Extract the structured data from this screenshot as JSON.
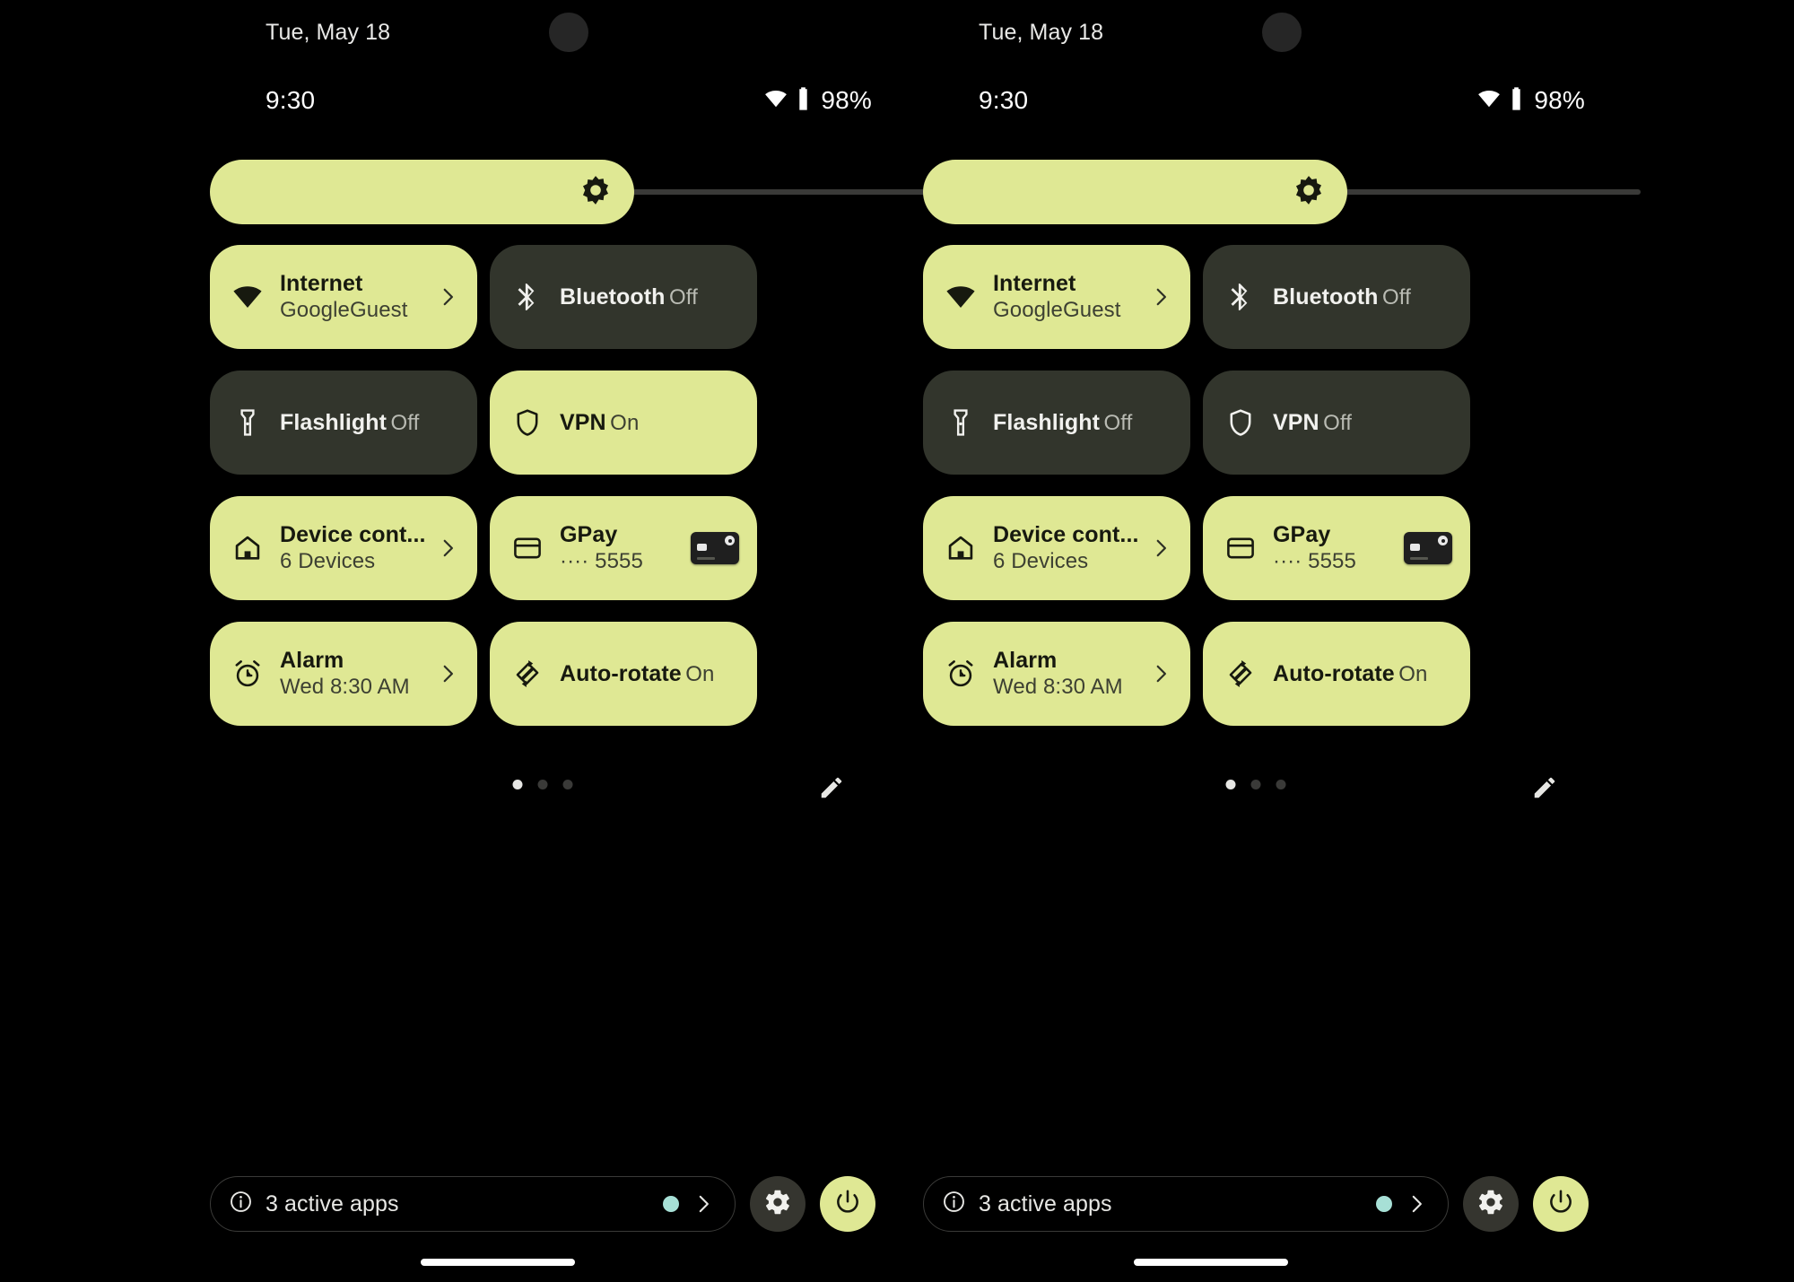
{
  "theme": {
    "background": "#000000",
    "tile_active_bg": "#dfe894",
    "tile_inactive_bg": "#32352c",
    "accent": "#dfe894",
    "active_apps_dot": "#a7e0d6"
  },
  "panels": [
    {
      "id": "panel-left",
      "status_bar": {
        "date": "Tue, May 18",
        "time": "9:30",
        "wifi_icon": "wifi-icon",
        "battery_icon": "battery-icon",
        "battery_percent": "98%"
      },
      "brightness": {
        "name": "brightness-slider",
        "icon": "brightness-icon",
        "value_percent": 59
      },
      "tiles": [
        {
          "name": "internet",
          "label": "Internet",
          "state": "GoogleGuest",
          "icon": "wifi-icon",
          "active": true,
          "chevron": true,
          "thumbnail": null
        },
        {
          "name": "bluetooth",
          "label": "Bluetooth",
          "state": "Off",
          "icon": "bluetooth-icon",
          "active": false,
          "chevron": false,
          "thumbnail": null
        },
        {
          "name": "flashlight",
          "label": "Flashlight",
          "state": "Off",
          "icon": "flashlight-icon",
          "active": false,
          "chevron": false,
          "thumbnail": null
        },
        {
          "name": "vpn",
          "label": "VPN",
          "state": "On",
          "icon": "shield-icon",
          "active": true,
          "chevron": false,
          "thumbnail": null
        },
        {
          "name": "device-controls",
          "label": "Device cont...",
          "state": "6 Devices",
          "icon": "home-icon",
          "active": true,
          "chevron": true,
          "thumbnail": null
        },
        {
          "name": "gpay",
          "label": "GPay",
          "state": "···· 5555",
          "icon": "credit-card-icon",
          "active": true,
          "chevron": false,
          "thumbnail": "payment-card-thumbnail"
        },
        {
          "name": "alarm",
          "label": "Alarm",
          "state": "Wed 8:30 AM",
          "icon": "alarm-clock-icon",
          "active": true,
          "chevron": true,
          "thumbnail": null
        },
        {
          "name": "auto-rotate",
          "label": "Auto-rotate",
          "state": "On",
          "icon": "auto-rotate-icon",
          "active": true,
          "chevron": false,
          "thumbnail": null
        }
      ],
      "pager": {
        "pages": 3,
        "current": 1
      },
      "edit_button": {
        "name": "edit-tiles-button",
        "icon": "pencil-icon"
      },
      "bottom": {
        "active_apps_label": "3 active apps",
        "info_icon": "info-icon",
        "chevron_icon": "chevron-right-icon",
        "settings_icon": "gear-icon",
        "power_icon": "power-icon"
      }
    },
    {
      "id": "panel-right",
      "status_bar": {
        "date": "Tue, May 18",
        "time": "9:30",
        "wifi_icon": "wifi-icon",
        "battery_icon": "battery-icon",
        "battery_percent": "98%"
      },
      "brightness": {
        "name": "brightness-slider",
        "icon": "brightness-icon",
        "value_percent": 59
      },
      "tiles": [
        {
          "name": "internet",
          "label": "Internet",
          "state": "GoogleGuest",
          "icon": "wifi-icon",
          "active": true,
          "chevron": true,
          "thumbnail": null
        },
        {
          "name": "bluetooth",
          "label": "Bluetooth",
          "state": "Off",
          "icon": "bluetooth-icon",
          "active": false,
          "chevron": false,
          "thumbnail": null
        },
        {
          "name": "flashlight",
          "label": "Flashlight",
          "state": "Off",
          "icon": "flashlight-icon",
          "active": false,
          "chevron": false,
          "thumbnail": null
        },
        {
          "name": "vpn",
          "label": "VPN",
          "state": "Off",
          "icon": "shield-icon",
          "active": false,
          "chevron": false,
          "thumbnail": null
        },
        {
          "name": "device-controls",
          "label": "Device cont...",
          "state": "6 Devices",
          "icon": "home-icon",
          "active": true,
          "chevron": true,
          "thumbnail": null
        },
        {
          "name": "gpay",
          "label": "GPay",
          "state": "···· 5555",
          "icon": "credit-card-icon",
          "active": true,
          "chevron": false,
          "thumbnail": "payment-card-thumbnail"
        },
        {
          "name": "alarm",
          "label": "Alarm",
          "state": "Wed 8:30 AM",
          "icon": "alarm-clock-icon",
          "active": true,
          "chevron": true,
          "thumbnail": null
        },
        {
          "name": "auto-rotate",
          "label": "Auto-rotate",
          "state": "On",
          "icon": "auto-rotate-icon",
          "active": true,
          "chevron": false,
          "thumbnail": null
        }
      ],
      "pager": {
        "pages": 3,
        "current": 1
      },
      "edit_button": {
        "name": "edit-tiles-button",
        "icon": "pencil-icon"
      },
      "bottom": {
        "active_apps_label": "3 active apps",
        "info_icon": "info-icon",
        "chevron_icon": "chevron-right-icon",
        "settings_icon": "gear-icon",
        "power_icon": "power-icon"
      }
    }
  ]
}
